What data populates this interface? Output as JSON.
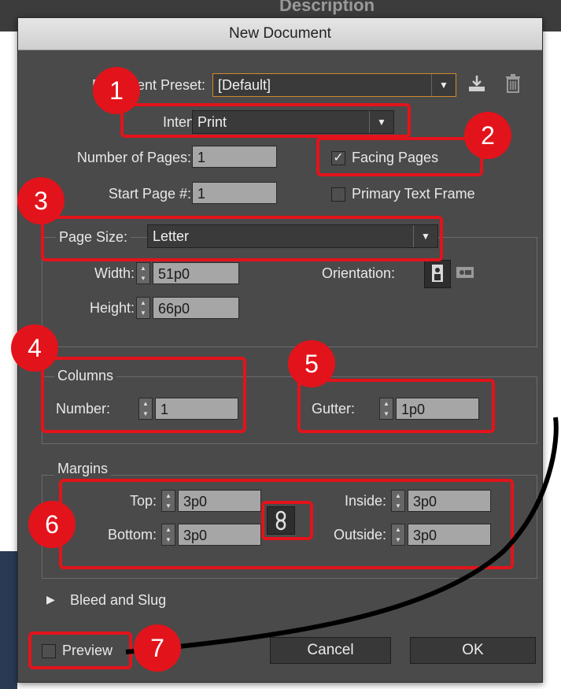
{
  "background_title": "Description",
  "dialog": {
    "title": "New Document",
    "preset_label": "Document Preset:",
    "preset_value": "[Default]",
    "intent_label": "Intent:",
    "intent_value": "Print",
    "pages_label": "Number of Pages:",
    "pages_value": "1",
    "start_label": "Start Page #:",
    "start_value": "1",
    "facing_pages_label": "Facing Pages",
    "facing_pages_checked": "✓",
    "primary_text_label": "Primary Text Frame",
    "page_size_label": "Page Size:",
    "page_size_value": "Letter",
    "width_label": "Width:",
    "width_value": "51p0",
    "height_label": "Height:",
    "height_value": "66p0",
    "orientation_label": "Orientation:",
    "columns_legend": "Columns",
    "number_label": "Number:",
    "number_value": "1",
    "gutter_label": "Gutter:",
    "gutter_value": "1p0",
    "margins_legend": "Margins",
    "top_label": "Top:",
    "top_value": "3p0",
    "bottom_label": "Bottom:",
    "bottom_value": "3p0",
    "inside_label": "Inside:",
    "inside_value": "3p0",
    "outside_label": "Outside:",
    "outside_value": "3p0",
    "bleed_label": "Bleed and Slug",
    "preview_label": "Preview",
    "cancel_label": "Cancel",
    "ok_label": "OK"
  },
  "callouts": [
    "1",
    "2",
    "3",
    "4",
    "5",
    "6",
    "7"
  ],
  "icons": {
    "save_preset": "download-tray-icon",
    "delete_preset": "trash-icon",
    "portrait": "portrait-orientation-icon",
    "landscape": "landscape-orientation-icon",
    "link": "chain-link-icon",
    "disclosure": "triangle-right-icon"
  },
  "colors": {
    "callout": "#e3131b",
    "dialog_bg": "#4a4a4a"
  }
}
